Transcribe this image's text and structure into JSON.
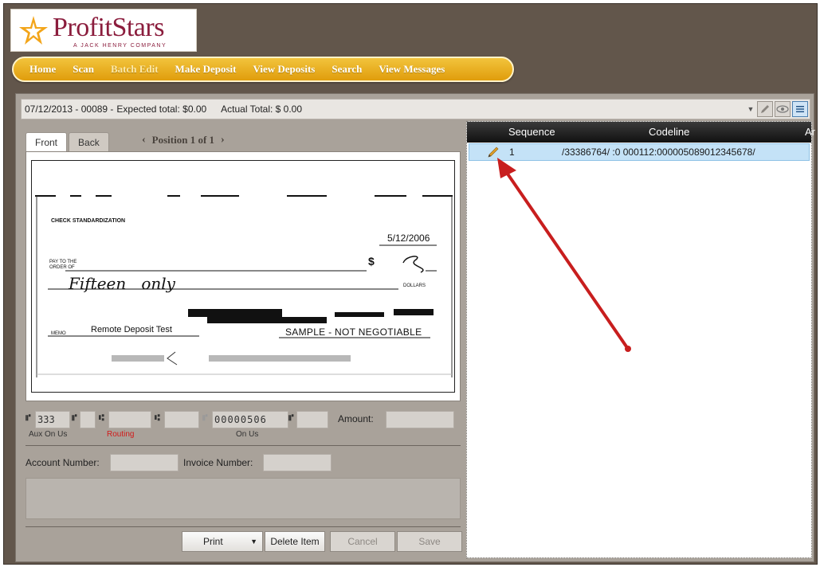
{
  "brand": {
    "name": "ProfitStars",
    "tagline": "A JACK HENRY COMPANY",
    "colors": {
      "brand": "#8b1d3d",
      "nav": "#eab125",
      "accent": "#f3a51a"
    }
  },
  "nav": {
    "items": [
      {
        "label": "Home"
      },
      {
        "label": "Scan"
      },
      {
        "label": "Batch Edit",
        "active": true
      },
      {
        "label": "Make Deposit"
      },
      {
        "label": "View Deposits"
      },
      {
        "label": "Search"
      },
      {
        "label": "View Messages"
      }
    ]
  },
  "infobar": {
    "batch": "07/12/2013 - 00089 -",
    "expected": "Expected total: $0.00",
    "actual": "Actual Total: $ 0.00",
    "tools": [
      "dropdown-arrow-icon",
      "pencil-icon",
      "eye-icon",
      "list-icon"
    ]
  },
  "viewer": {
    "tabs": [
      {
        "label": "Front",
        "active": true
      },
      {
        "label": "Back"
      }
    ],
    "prev_icon": "‹",
    "next_icon": "›",
    "position": "Position 1 of 1"
  },
  "check": {
    "title": "CHECK STANDARDIZATION",
    "date": "5/12/2006",
    "payto_line1": "PAY TO THE",
    "payto_line2": "ORDER OF",
    "amount_symbol": "$",
    "amount": "5",
    "written_amount": "Fifteen   only",
    "dollars_label": "DOLLARS",
    "memo_label": "MEMO",
    "memo_text": "Remote Deposit Test",
    "watermark": "SAMPLE - NOT NEGOTIABLE"
  },
  "micr": {
    "aux_on_us": "333",
    "aux_label": "Aux On Us",
    "routing_label": "Routing",
    "on_us_value": "00000506",
    "on_us_label": "On Us",
    "amount_label": "Amount:"
  },
  "fields": {
    "account_label": "Account Number:",
    "invoice_label": "Invoice Number:"
  },
  "buttons": {
    "print": "Print",
    "delete": "Delete Item",
    "cancel": "Cancel",
    "save": "Save"
  },
  "grid": {
    "headers": {
      "sequence": "Sequence",
      "codeline": "Codeline",
      "amount_partial": "Ar"
    },
    "rows": [
      {
        "sequence": "1",
        "codeline": "/33386764/ :0  000112:000005089012345678/"
      }
    ]
  }
}
